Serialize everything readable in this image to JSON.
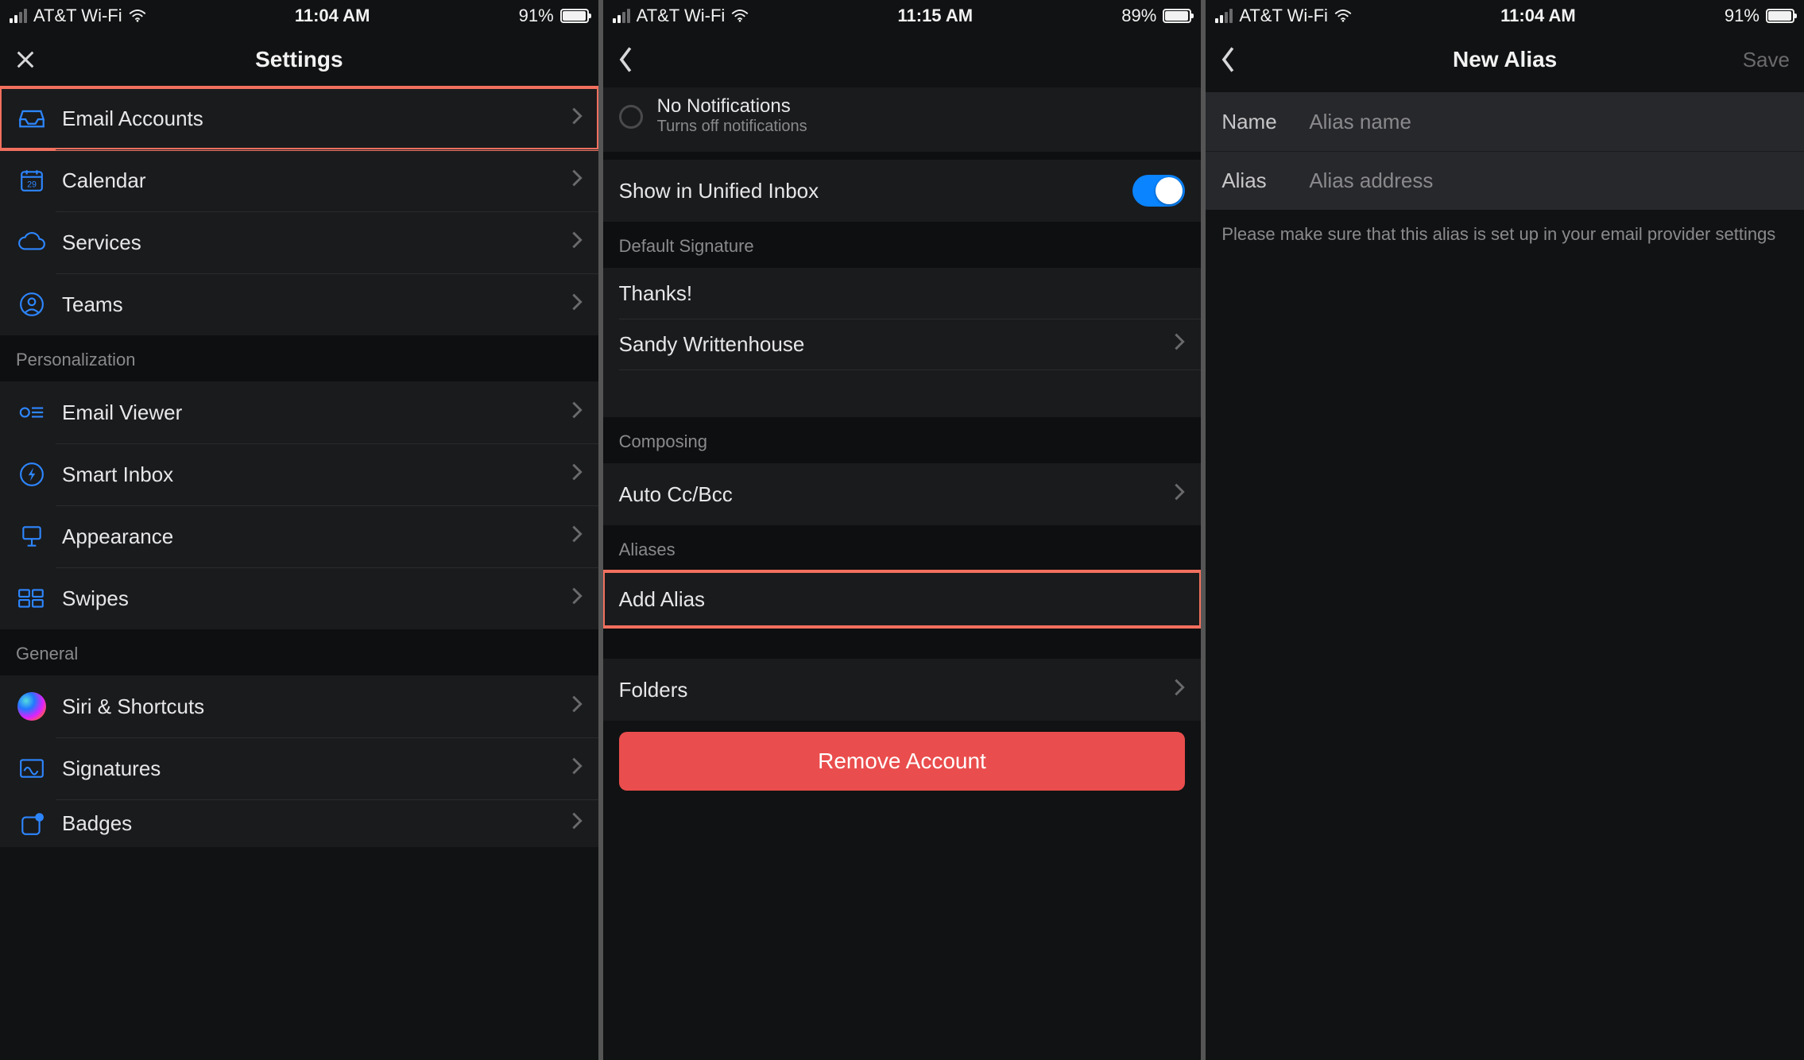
{
  "screens": [
    {
      "status": {
        "carrier": "AT&T Wi-Fi",
        "time": "11:04 AM",
        "battery_pct": "91%",
        "battery_fill": 91
      },
      "nav": {
        "title": "Settings"
      },
      "groups": {
        "g1": [
          {
            "label": "Email Accounts",
            "icon": "inbox-icon"
          },
          {
            "label": "Calendar",
            "icon": "calendar-icon"
          },
          {
            "label": "Services",
            "icon": "cloud-icon"
          },
          {
            "label": "Teams",
            "icon": "person-icon"
          }
        ],
        "personalization_header": "Personalization",
        "g2": [
          {
            "label": "Email Viewer",
            "icon": "viewer-icon"
          },
          {
            "label": "Smart Inbox",
            "icon": "bolt-icon"
          },
          {
            "label": "Appearance",
            "icon": "appearance-icon"
          },
          {
            "label": "Swipes",
            "icon": "swipes-icon"
          }
        ],
        "general_header": "General",
        "g3": [
          {
            "label": "Siri & Shortcuts",
            "icon": "siri-icon"
          },
          {
            "label": "Signatures",
            "icon": "signature-icon"
          },
          {
            "label": "Badges",
            "icon": "badges-icon"
          }
        ]
      }
    },
    {
      "status": {
        "carrier": "AT&T Wi-Fi",
        "time": "11:15 AM",
        "battery_pct": "89%",
        "battery_fill": 89
      },
      "nav": {
        "title": ""
      },
      "no_notifications": {
        "title": "No Notifications",
        "subtitle": "Turns off notifications"
      },
      "unified": "Show in Unified Inbox",
      "default_signature_header": "Default Signature",
      "signature_text": "Thanks!",
      "signature_name": "Sandy Writtenhouse",
      "composing_header": "Composing",
      "auto_cc": "Auto Cc/Bcc",
      "aliases_header": "Aliases",
      "add_alias": "Add Alias",
      "folders": "Folders",
      "remove": "Remove Account"
    },
    {
      "status": {
        "carrier": "AT&T Wi-Fi",
        "time": "11:04 AM",
        "battery_pct": "91%",
        "battery_fill": 91
      },
      "nav": {
        "title": "New Alias",
        "right": "Save"
      },
      "form": {
        "name_label": "Name",
        "name_placeholder": "Alias name",
        "alias_label": "Alias",
        "alias_placeholder": "Alias address"
      },
      "hint": "Please make sure that this alias is set up in your email provider settings"
    }
  ]
}
